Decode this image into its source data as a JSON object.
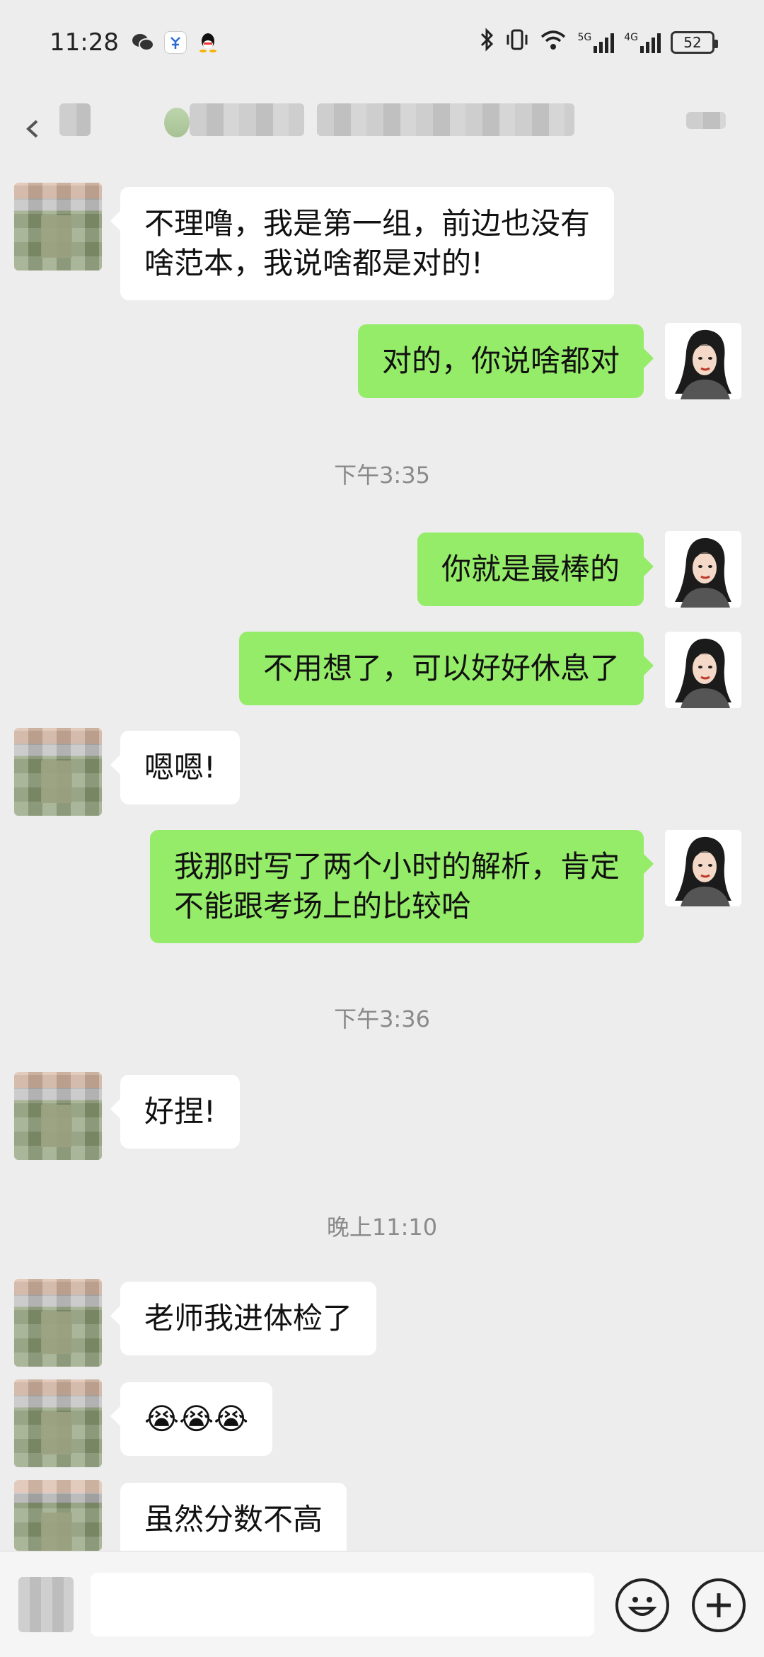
{
  "status_bar": {
    "time": "11:28",
    "app_icons": [
      "wechat-icon",
      "taobao-icon",
      "qq-icon"
    ],
    "network_1": "5G",
    "network_2": "4G",
    "battery": "52"
  },
  "messages": [
    {
      "from": "friend",
      "text_lines": [
        "不理噜，我是第一组，前边也没有",
        "啥范本，我说啥都是对的!"
      ]
    },
    {
      "from": "me",
      "text": "对的，你说啥都对"
    },
    {
      "timestamp": "下午3:35"
    },
    {
      "from": "me",
      "text": "你就是最棒的"
    },
    {
      "from": "me",
      "text": "不用想了，可以好好休息了"
    },
    {
      "from": "friend",
      "text": "嗯嗯!"
    },
    {
      "from": "me",
      "text_lines": [
        "我那时写了两个小时的解析，肯定",
        "不能跟考场上的比较哈"
      ]
    },
    {
      "timestamp": "下午3:36"
    },
    {
      "from": "friend",
      "text": "好捏!"
    },
    {
      "timestamp": "晚上11:10"
    },
    {
      "from": "friend",
      "text": "老师我进体检了"
    },
    {
      "from": "friend",
      "text": "😭😭😭"
    },
    {
      "from": "friend",
      "text": "虽然分数不高"
    }
  ],
  "colors": {
    "background": "#ededed",
    "out_bubble": "#95ec69",
    "in_bubble": "#ffffff",
    "timestamp": "#8a8a8a"
  }
}
